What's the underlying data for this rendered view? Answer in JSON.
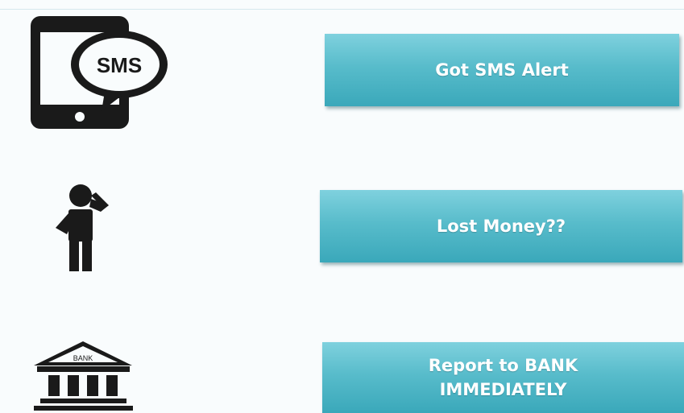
{
  "steps": [
    {
      "icon": "sms-phone-icon",
      "text": "Got SMS Alert"
    },
    {
      "icon": "confused-person-icon",
      "text": "Lost Money??"
    },
    {
      "icon": "bank-icon",
      "text": "Report to BANK IMMEDIATELY"
    }
  ],
  "sms_icon_label": "SMS",
  "bank_icon_label": "BANK",
  "colors": {
    "box_accent": "#58bccb",
    "icon": "#1a1a1a"
  }
}
